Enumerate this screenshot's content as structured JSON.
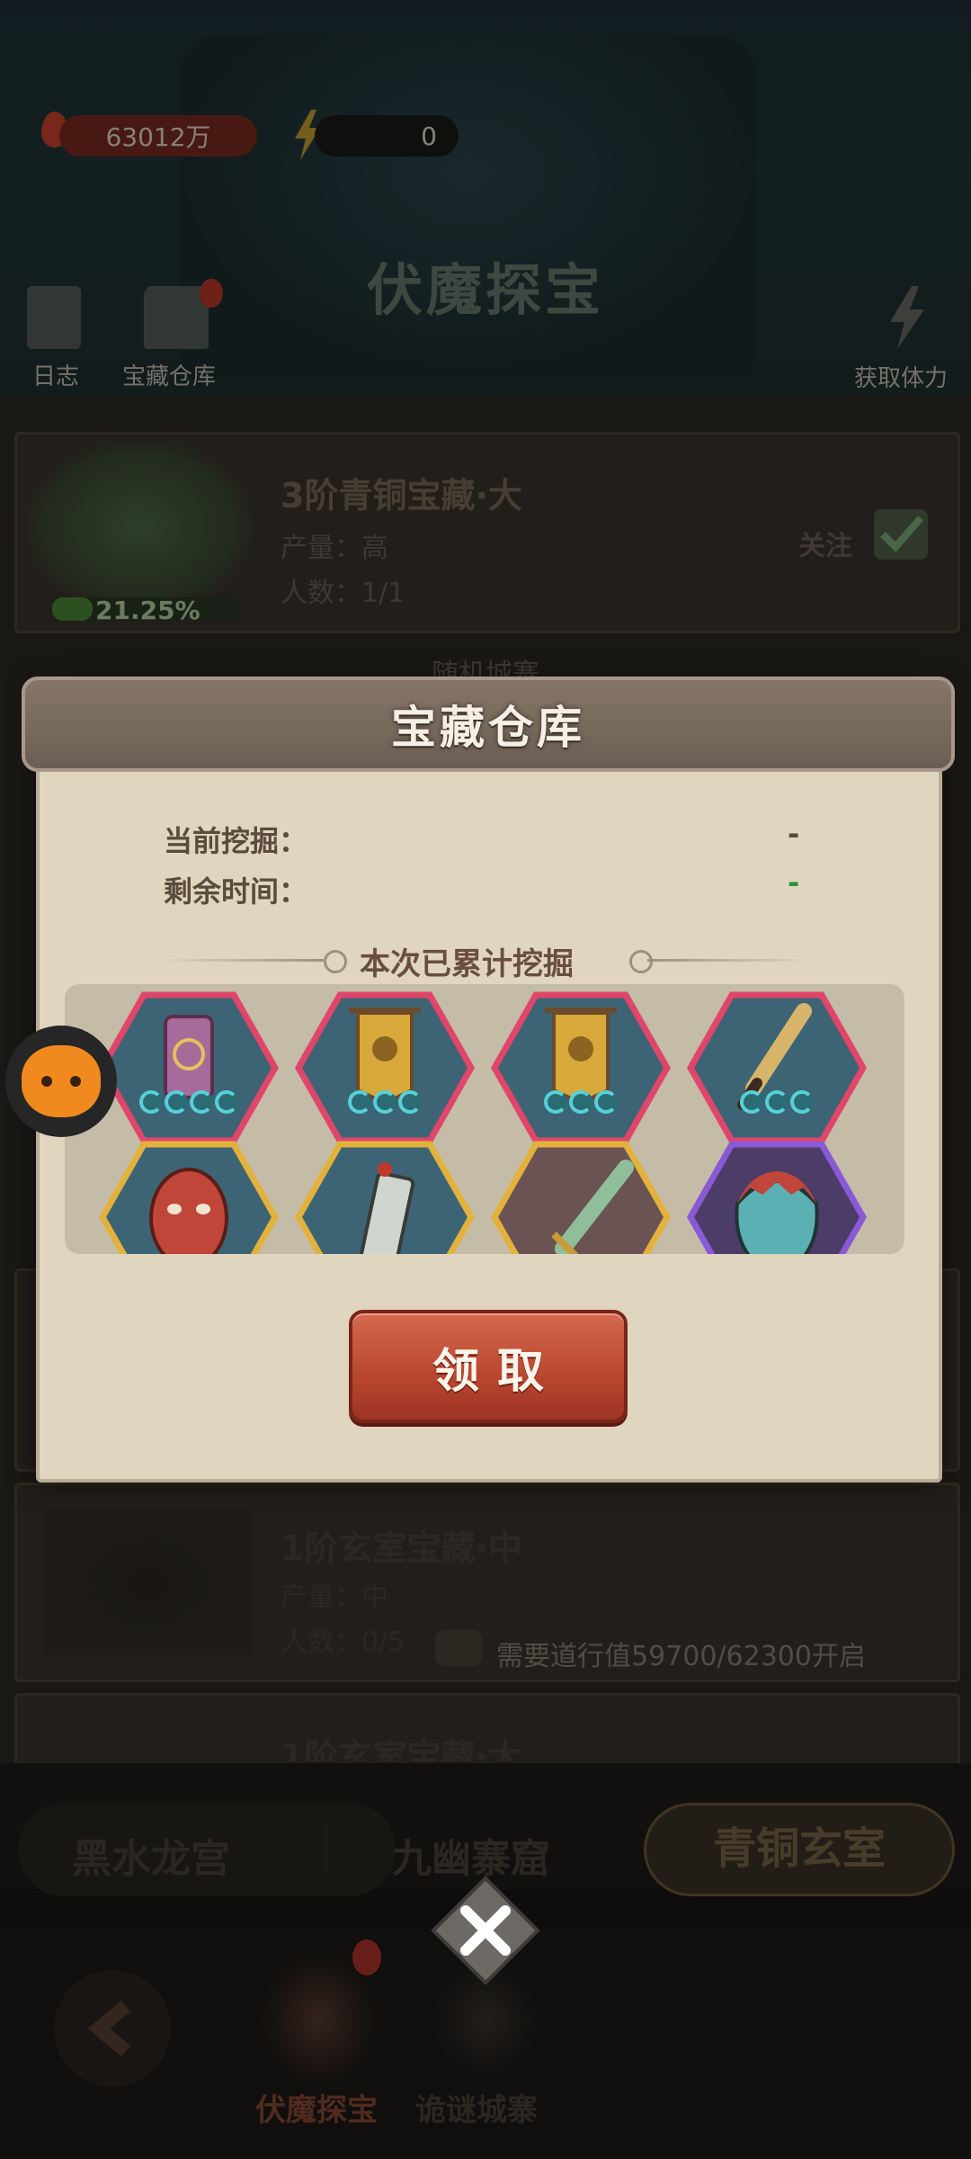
{
  "top_bar": {
    "currency_value": "63012万",
    "energy_value": "0"
  },
  "header": {
    "title": "伏魔探宝",
    "log_label": "日志",
    "warehouse_label": "宝藏仓库",
    "get_stamina_label": "获取体力"
  },
  "treasure_cards": [
    {
      "title": "3阶青铜宝藏·大",
      "output": "产量：高",
      "people": "人数：1/1",
      "progress": "21.25%",
      "follow_label": "关注"
    },
    {
      "title": "1阶玄室宝藏·中",
      "output": "产量：中",
      "people": "人数：0/5",
      "requirement": "需要道行值59700/62300开启"
    },
    {
      "title": "1阶玄室宝藏·大"
    }
  ],
  "random_city_label": "随机城寨",
  "popup": {
    "title": "宝藏仓库",
    "current_dig_label": "当前挖掘：",
    "current_dig_value": "-",
    "remaining_time_label": "剩余时间：",
    "remaining_time_value": "-",
    "section_title": "本次已累计挖掘",
    "items": [
      {
        "icon": "scroll-icon",
        "frame": "pink",
        "stars": 4
      },
      {
        "icon": "banner-icon",
        "frame": "pink",
        "stars": 3
      },
      {
        "icon": "banner-icon",
        "frame": "pink",
        "stars": 3
      },
      {
        "icon": "brush-icon",
        "frame": "pink",
        "stars": 3
      },
      {
        "icon": "mask-icon",
        "frame": "gold",
        "stars": 0
      },
      {
        "icon": "talisman-icon",
        "frame": "gold",
        "stars": 0
      },
      {
        "icon": "sword-icon",
        "frame": "gold",
        "stars": 0
      },
      {
        "icon": "demon-mask-icon",
        "frame": "purple",
        "stars": 0
      }
    ],
    "claim_label": "领取"
  },
  "tabs": [
    "黑水龙宫",
    "九幽寨窟",
    "青铜玄室"
  ],
  "bottom_nav": {
    "treasure_label": "伏魔探宝",
    "city_label": "诡谜城寨"
  },
  "colors": {
    "pink_frame": "#e0456a",
    "gold_frame": "#e2b23c",
    "purple_frame": "#8a5ad6",
    "claim_button": "#c24b34",
    "dash_green": "#2f8f3a"
  }
}
